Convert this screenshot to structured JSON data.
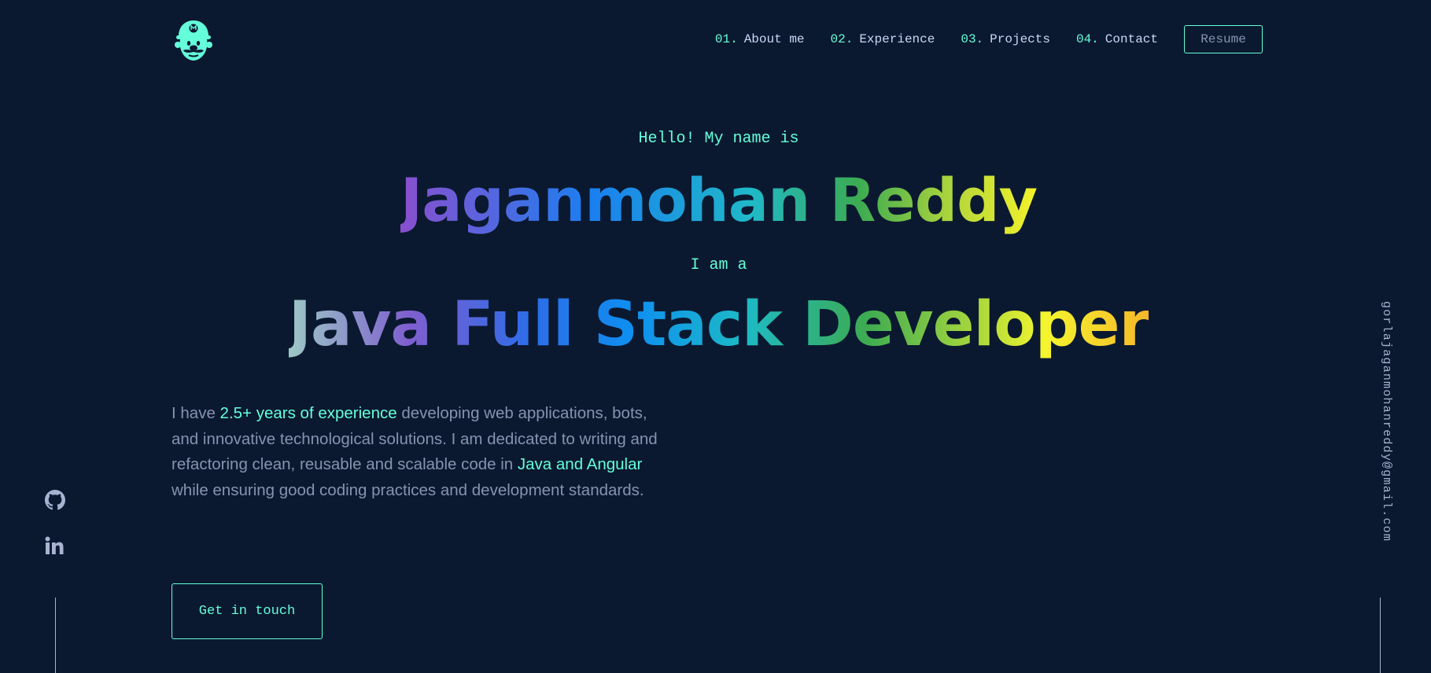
{
  "nav": {
    "items": [
      {
        "num": "01.",
        "label": "About me"
      },
      {
        "num": "02.",
        "label": "Experience"
      },
      {
        "num": "03.",
        "label": "Projects"
      },
      {
        "num": "04.",
        "label": "Contact"
      }
    ],
    "resume_label": "Resume"
  },
  "hero": {
    "greeting": "Hello! My name is",
    "name": "Jaganmohan Reddy",
    "iam": "I am a",
    "role": "Java Full Stack Developer"
  },
  "about": {
    "p1": "I have ",
    "h1": "2.5+ years of experience",
    "p2": " developing web applications, bots, and innovative technological solutions. I am dedicated to writing and refactoring clean, reusable and scalable code in ",
    "h2": "Java and Angular",
    "p3": " while ensuring good coding practices and development standards."
  },
  "cta_label": "Get in touch",
  "email": "gorlajaganmohanreddy@gmail.com",
  "social": {
    "icons": [
      "github-icon",
      "linkedin-icon"
    ]
  },
  "colors": {
    "background": "#0b1930",
    "accent": "#64ffda",
    "text_primary": "#ccd6f6",
    "text_secondary": "#8892b0"
  }
}
